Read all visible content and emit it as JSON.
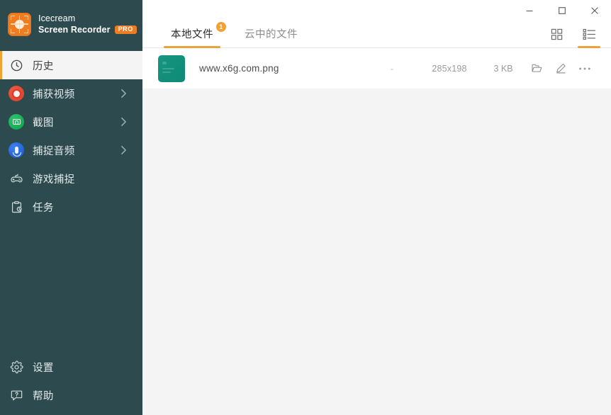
{
  "app": {
    "brand_line1": "Icecream",
    "brand_line2": "Screen Recorder",
    "pro_badge": "PRO"
  },
  "window_controls": {
    "minimize": "minimize-button",
    "maximize": "maximize-button",
    "close": "close-button"
  },
  "sidebar": {
    "items": [
      {
        "label": "历史",
        "icon": "clock-icon",
        "active": true,
        "chevron": false
      },
      {
        "label": "捕获视频",
        "icon": "record-video-icon",
        "active": false,
        "chevron": true
      },
      {
        "label": "截图",
        "icon": "screenshot-camera-icon",
        "active": false,
        "chevron": true
      },
      {
        "label": "捕捉音频",
        "icon": "microphone-icon",
        "active": false,
        "chevron": true
      },
      {
        "label": "游戏捕捉",
        "icon": "gamepad-icon",
        "active": false,
        "chevron": false
      },
      {
        "label": "任务",
        "icon": "task-clipboard-icon",
        "active": false,
        "chevron": false
      }
    ],
    "bottom_items": [
      {
        "label": "设置",
        "icon": "gear-icon"
      },
      {
        "label": "帮助",
        "icon": "help-question-icon"
      }
    ]
  },
  "tabs": [
    {
      "label": "本地文件",
      "active": true,
      "badge": "1"
    },
    {
      "label": "云中的文件",
      "active": false,
      "badge": ""
    }
  ],
  "view_toggles": [
    {
      "name": "grid-view",
      "active": false
    },
    {
      "name": "list-view",
      "active": true
    }
  ],
  "files": [
    {
      "name": "www.x6g.com.png",
      "duration": "-",
      "dimensions": "285x198",
      "size": "3 KB",
      "actions": [
        "open-folder",
        "edit",
        "more"
      ]
    }
  ],
  "colors": {
    "sidebar_bg": "#2d4a4e",
    "accent_orange": "#f0a132",
    "brand_orange": "#f07c22",
    "content_bg": "#f4f4f4",
    "thumb_teal": "#0e8a77"
  }
}
